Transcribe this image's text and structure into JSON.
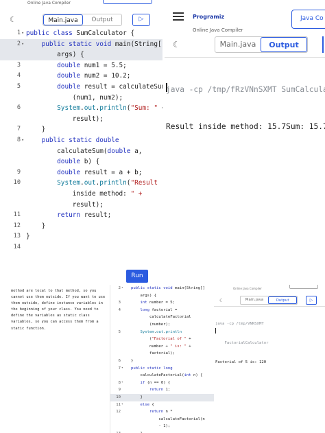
{
  "top_left": {
    "brand": "Online Java Compiler",
    "tabs": [
      "Main.java",
      "Output"
    ],
    "active_tab": "Main.java",
    "run_icon": "play-icon",
    "run_label": "Run",
    "lines": [
      {
        "n": "1",
        "fold": "▾",
        "text": "public class SumCalculator {"
      },
      {
        "n": "2",
        "fold": "▾",
        "text": "    public static void main(String[]",
        "hl": true
      },
      {
        "n": "",
        "fold": "",
        "text": "        args) {",
        "hl": true
      },
      {
        "n": "3",
        "fold": "",
        "text": "        double num1 = 5.5;"
      },
      {
        "n": "4",
        "fold": "",
        "text": "        double num2 = 10.2;"
      },
      {
        "n": "5",
        "fold": "",
        "text": "        double result = calculateSum"
      },
      {
        "n": "",
        "fold": "",
        "text": "            (num1, num2);"
      },
      {
        "n": "6",
        "fold": "",
        "text": "        System.out.println(\"Sum: \" +"
      },
      {
        "n": "",
        "fold": "",
        "text": "            result);"
      },
      {
        "n": "7",
        "fold": "",
        "text": "    }"
      },
      {
        "n": "8",
        "fold": "▾",
        "text": "    public static double"
      },
      {
        "n": "",
        "fold": "",
        "text": "        calculateSum(double a,"
      },
      {
        "n": "",
        "fold": "",
        "text": "        double b) {"
      },
      {
        "n": "9",
        "fold": "",
        "text": "        double result = a + b;"
      },
      {
        "n": "10",
        "fold": "",
        "text": "        System.out.println(\"Result"
      },
      {
        "n": "",
        "fold": "",
        "text": "            inside method: \" +"
      },
      {
        "n": "",
        "fold": "",
        "text": "            result);"
      },
      {
        "n": "11",
        "fold": "",
        "text": "        return result;"
      },
      {
        "n": "12",
        "fold": "",
        "text": "    }"
      },
      {
        "n": "13",
        "fold": "",
        "text": "}"
      },
      {
        "n": "14",
        "fold": "",
        "text": ""
      }
    ]
  },
  "top_right": {
    "logo": "Programiz",
    "subtitle": "Online Java Compiler",
    "header_button": "Java Co",
    "tabs": [
      "Main.java",
      "Output"
    ],
    "active_tab": "Output",
    "command": "java -cp /tmp/fRzVNnSXMT SumCalcula",
    "result": "Result inside method: 15.7Sum: 15.7"
  },
  "bottom_left": {
    "text": "method are local to that method, so you cannot use them outside. If you want to use them outside, define instance variables in the beginning of your class. You need to define the variables as static class variables, so you can access them from a static function."
  },
  "bottom_middle": {
    "lines": [
      {
        "n": "2",
        "fold": "▾",
        "text": "public static void main(String[]"
      },
      {
        "n": "",
        "fold": "",
        "text": "    args) {"
      },
      {
        "n": "3",
        "fold": "",
        "text": "    int number = 5;"
      },
      {
        "n": "4",
        "fold": "",
        "text": "    long factorial ="
      },
      {
        "n": "",
        "fold": "",
        "text": "        calculateFactorial"
      },
      {
        "n": "",
        "fold": "",
        "text": "        (number);"
      },
      {
        "n": "5",
        "fold": "",
        "text": "    System.out.println"
      },
      {
        "n": "",
        "fold": "",
        "text": "        (\"Factorial of \" +"
      },
      {
        "n": "",
        "fold": "",
        "text": "        number + \" is: \" +"
      },
      {
        "n": "",
        "fold": "",
        "text": "        factorial);"
      },
      {
        "n": "6",
        "fold": "",
        "text": "}"
      },
      {
        "n": "7",
        "fold": "▾",
        "text": "public static long"
      },
      {
        "n": "",
        "fold": "",
        "text": "    calculateFactorial(int n) {"
      },
      {
        "n": "8",
        "fold": "▾",
        "text": "    if (n == 0) {"
      },
      {
        "n": "9",
        "fold": "",
        "text": "        return 1;"
      },
      {
        "n": "10",
        "fold": "",
        "text": "    }",
        "hl": true
      },
      {
        "n": "11",
        "fold": "▾",
        "text": "    else {"
      },
      {
        "n": "12",
        "fold": "",
        "text": "        return n *"
      },
      {
        "n": "",
        "fold": "",
        "text": "            calculateFactorial(n"
      },
      {
        "n": "",
        "fold": "",
        "text": "            - 1);"
      },
      {
        "n": "13",
        "fold": "",
        "text": "    }"
      },
      {
        "n": "14",
        "fold": "",
        "text": "}"
      }
    ]
  },
  "bottom_right": {
    "brand": "Online Java Compiler",
    "tabs": [
      "Main.java",
      "Output"
    ],
    "active_tab": "Output",
    "command_1": "java -cp /tmp/VNNSXMT",
    "command_2": "    FactorialCalculator",
    "result": "Factorial of 5 is: 120"
  },
  "colors": {
    "accent": "#2b5be0",
    "keyword": "#1f2fbf",
    "string": "#b01c1c"
  }
}
